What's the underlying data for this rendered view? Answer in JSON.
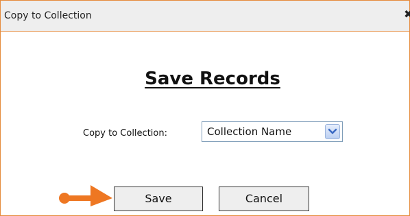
{
  "dialog": {
    "title": "Copy to Collection",
    "close_glyph": "✖",
    "heading": "Save Records",
    "field_label": "Copy to Collection:",
    "select_value": "Collection Name",
    "save_label": "Save",
    "cancel_label": "Cancel"
  },
  "icons": {
    "close": "close-icon",
    "dropdown": "chevron-down-icon",
    "annotation": "arrow-right-icon"
  },
  "colors": {
    "border": "#e58a3a",
    "titlebar_bg": "#eeeeee",
    "arrow": "#ee7722",
    "dropdown_accent": "#3c6bc4"
  }
}
